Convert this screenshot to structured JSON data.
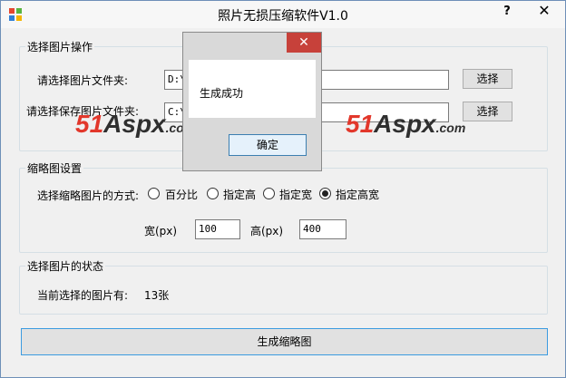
{
  "window": {
    "title": "照片无损压缩软件V1.0",
    "help": "?",
    "close": "✕"
  },
  "select_group": {
    "legend": "选择图片操作",
    "source_label": "请选择图片文件夹:",
    "source_value": "D:\\",
    "source_button": "选择",
    "save_label": "请选择保存图片文件夹:",
    "save_value": "C:\\",
    "save_button": "选择"
  },
  "thumb_group": {
    "legend": "缩略图设置",
    "mode_label": "选择缩略图片的方式:",
    "options": [
      {
        "label": "百分比",
        "checked": false
      },
      {
        "label": "指定高",
        "checked": false
      },
      {
        "label": "指定宽",
        "checked": false
      },
      {
        "label": "指定高宽",
        "checked": true
      }
    ],
    "width_label": "宽(px)",
    "width_value": "100",
    "height_label": "高(px)",
    "height_value": "400"
  },
  "status_group": {
    "legend": "选择图片的状态",
    "count_label": "当前选择的图片有:",
    "count_value": "13张"
  },
  "generate_button": "生成缩略图",
  "watermark": {
    "num": "51",
    "aspx": "Aspx",
    "com": ".com"
  },
  "dialog": {
    "message": "生成成功",
    "ok": "确定",
    "close": "✕"
  }
}
